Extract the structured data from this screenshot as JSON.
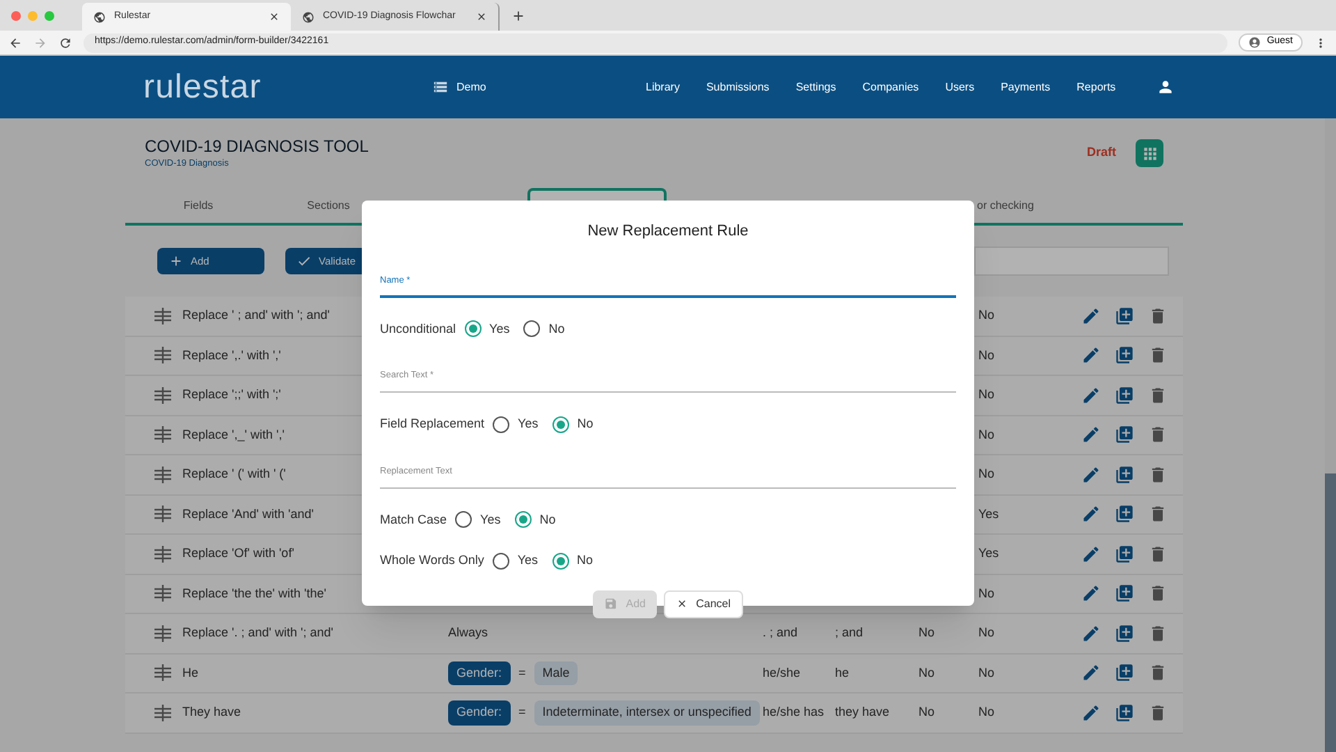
{
  "browser": {
    "tabs": [
      {
        "label": "Rulestar",
        "selected": true
      },
      {
        "label": "COVID-19 Diagnosis Flowchar",
        "selected": false
      }
    ],
    "url": "https://demo.rulestar.com/admin/form-builder/3422161",
    "profile": "Guest"
  },
  "header": {
    "logo": "rulestar",
    "workspace": "Demo",
    "nav": [
      "Library",
      "Submissions",
      "Settings",
      "Companies",
      "Users",
      "Payments",
      "Reports"
    ]
  },
  "form": {
    "title": "COVID-19 DIAGNOSIS TOOL",
    "subtitle": "COVID-19 Diagnosis",
    "status": "Draft"
  },
  "tabs": [
    {
      "label": "Fields",
      "selected": false
    },
    {
      "label": "Sections",
      "selected": false
    },
    {
      "selected": true
    },
    {
      "label": "or checking",
      "selected": false
    }
  ],
  "toolbar": {
    "buttons": [
      {
        "kind": "add",
        "label": "Add"
      },
      {
        "kind": "validate",
        "label": "Validate"
      }
    ]
  },
  "rules": [
    {
      "name": "Replace ' ; and' with '; and'",
      "column_6": "No"
    },
    {
      "name": "Replace ',.' with ','",
      "column_6": "No"
    },
    {
      "name": "Replace ';;' with ';'",
      "column_6": "No"
    },
    {
      "name": "Replace ',_' with ','",
      "column_6": "No"
    },
    {
      "name": "Replace ' (' with ' ('",
      "column_6": "No"
    },
    {
      "name": "Replace 'And' with 'and'",
      "column_6": "Yes"
    },
    {
      "name": "Replace 'Of' with 'of'",
      "column_6": "Yes"
    },
    {
      "name": "Replace 'the the' with 'the'",
      "column_6": "No"
    },
    {
      "name": "Replace '. ; and' with '; and'",
      "condition": {
        "kind": "always",
        "text": "Always"
      },
      "search": ". ; and",
      "replacement": "; and",
      "column_5": "No",
      "column_6": "No"
    },
    {
      "name": "He",
      "condition": {
        "kind": "field",
        "field": "Gender:",
        "op": "=",
        "value": "Male"
      },
      "search": "he/she",
      "replacement": "he",
      "column_5": "No",
      "column_6": "No"
    },
    {
      "name": "They have",
      "condition": {
        "kind": "field",
        "field": "Gender:",
        "op": "=",
        "value": "Indeterminate, intersex or unspecified"
      },
      "search": "he/she has",
      "replacement": "they have",
      "column_5": "No",
      "column_6": "No"
    }
  ],
  "dialog": {
    "title": "New Replacement Rule",
    "fields": [
      {
        "kind": "text",
        "label": "Name *",
        "focused": true
      },
      {
        "kind": "radio",
        "label": "Unconditional",
        "options": [
          {
            "label": "Yes",
            "selected": true
          },
          {
            "label": "No",
            "selected": false
          }
        ]
      },
      {
        "kind": "text",
        "label": "Search Text *",
        "focused": false
      },
      {
        "kind": "radio",
        "label": "Field Replacement",
        "options": [
          {
            "label": "Yes",
            "selected": false
          },
          {
            "label": "No",
            "selected": true
          }
        ]
      },
      {
        "kind": "text",
        "label": "Replacement Text",
        "focused": false
      },
      {
        "kind": "radio",
        "label": "Match Case",
        "options": [
          {
            "label": "Yes",
            "selected": false
          },
          {
            "label": "No",
            "selected": true
          }
        ]
      },
      {
        "kind": "radio",
        "label": "Whole Words Only",
        "options": [
          {
            "label": "Yes",
            "selected": false
          },
          {
            "label": "No",
            "selected": true
          }
        ]
      }
    ],
    "buttons": [
      {
        "kind": "save",
        "label": "Add",
        "disabled": true
      },
      {
        "kind": "cancel",
        "label": "Cancel",
        "disabled": false
      }
    ]
  }
}
